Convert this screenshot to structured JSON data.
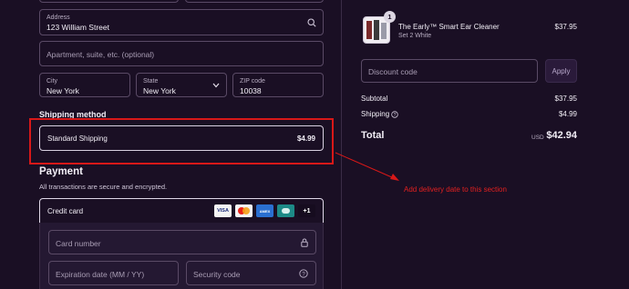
{
  "address": {
    "label": "Address",
    "value": "123 William Street",
    "apartment_placeholder": "Apartment, suite, etc. (optional)",
    "city_label": "City",
    "city_value": "New York",
    "state_label": "State",
    "state_value": "New York",
    "zip_label": "ZIP code",
    "zip_value": "10038"
  },
  "shipping": {
    "title": "Shipping method",
    "option_name": "Standard Shipping",
    "option_price": "$4.99"
  },
  "payment": {
    "title": "Payment",
    "subtitle": "All transactions are secure and encrypted.",
    "method": "Credit card",
    "cards": [
      "VISA",
      "mastercard",
      "AMEX",
      "diners",
      "+1"
    ],
    "card_number_placeholder": "Card number",
    "expiration_placeholder": "Expiration date (MM / YY)",
    "security_placeholder": "Security code"
  },
  "order": {
    "item_qty": "1",
    "item_name": "The Early™ Smart Ear Cleaner",
    "item_variant": "Set 2 White",
    "item_price": "$37.95",
    "discount_placeholder": "Discount code",
    "apply_label": "Apply",
    "subtotal_label": "Subtotal",
    "subtotal_value": "$37.95",
    "shipping_label": "Shipping",
    "shipping_value": "$4.99",
    "total_label": "Total",
    "currency": "USD",
    "total_value": "$42.94"
  },
  "annotation": {
    "text": "Add delivery date to this section",
    "color": "#e02020"
  },
  "colors": {
    "background": "#1a0f24",
    "accent_red": "#d81818"
  }
}
